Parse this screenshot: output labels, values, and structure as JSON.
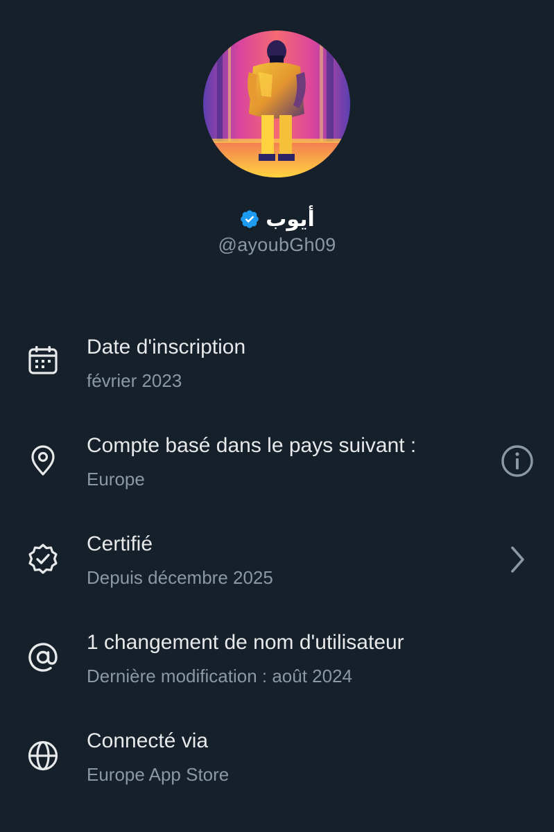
{
  "profile": {
    "display_name": "أيوب",
    "handle": "@ayoubGh09",
    "verified": true,
    "verified_badge_color": "#1d9bf0"
  },
  "about": {
    "items": [
      {
        "icon": "calendar-icon",
        "title": "Date d'inscription",
        "subtitle": "février 2023",
        "trailing": null
      },
      {
        "icon": "location-pin-icon",
        "title": "Compte basé dans le pays suivant :",
        "subtitle": "Europe",
        "trailing": "info-icon"
      },
      {
        "icon": "verified-badge-icon",
        "title": "Certifié",
        "subtitle": "Depuis décembre 2025",
        "trailing": "chevron-right-icon"
      },
      {
        "icon": "at-sign-icon",
        "title": "1 changement de nom d'utilisateur",
        "subtitle": "Dernière modification : août 2024",
        "trailing": null
      },
      {
        "icon": "globe-icon",
        "title": "Connecté via",
        "subtitle": "Europe App Store",
        "trailing": null
      }
    ]
  },
  "theme": {
    "background": "#15202b",
    "primary_text": "#e7e9ea",
    "secondary_text": "#8b98a5",
    "accent": "#1d9bf0"
  }
}
